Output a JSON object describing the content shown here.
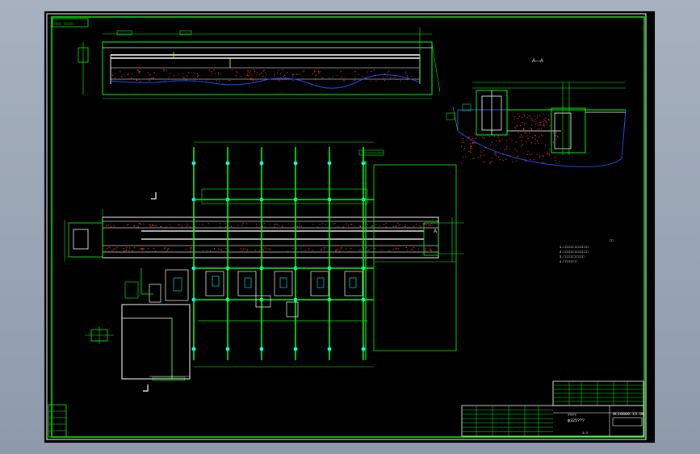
{
  "drawing": {
    "title_small": "□□□ □□□□",
    "section_label": "A—A",
    "view_mark": "A",
    "notes_title": "□□",
    "notes": [
      "1.□□□□□□□□□□□□□",
      "2.□□□□□□□□□□□□□",
      "3.□□□□□□□□□□□",
      "4.□□□□□□□"
    ],
    "title_block": {
      "drawing_no": "HC10000.13.00",
      "name": "φ325???",
      "scale_label": "????",
      "qty": "1:1"
    }
  },
  "colors": {
    "outline": "#00ff00",
    "white": "#ffffff",
    "red": "#ff2a2a",
    "blue": "#1f4bff",
    "cyan": "#00ffff",
    "yellow": "#ffff00",
    "magenta": "#ff00ff"
  }
}
